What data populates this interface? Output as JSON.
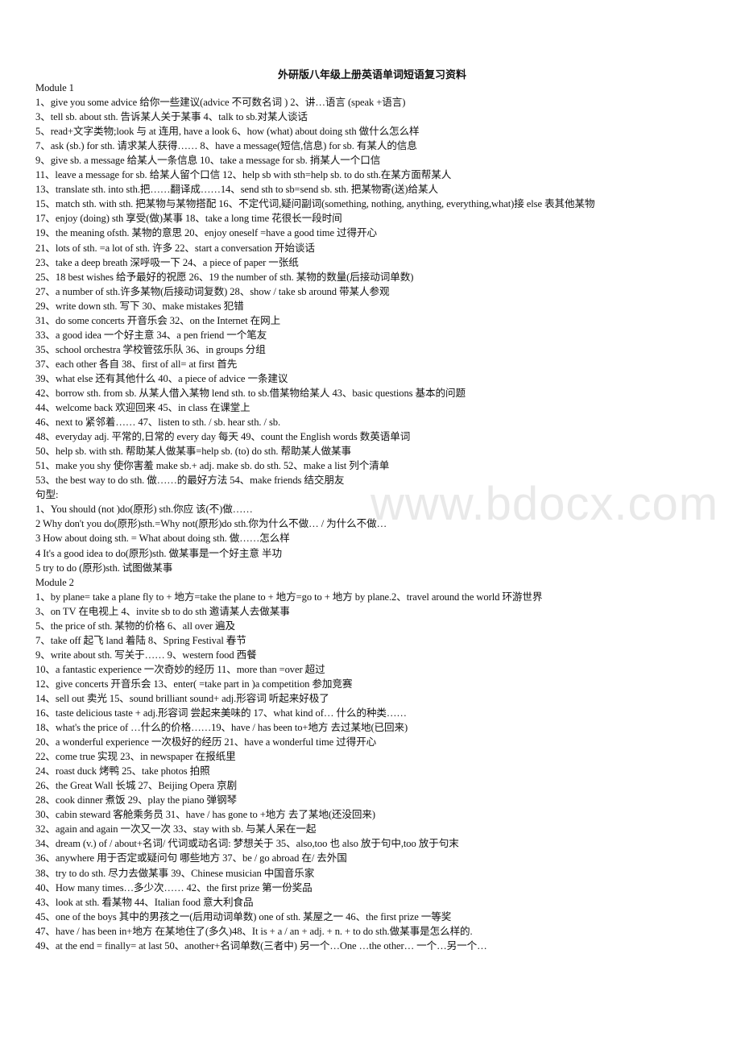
{
  "watermark": "www.bdocx.com",
  "document": {
    "title": "外研版八年级上册英语单词短语复习资料",
    "lines": [
      "Module 1",
      "1、give you some advice 给你一些建议(advice  不可数名词  ) 2、讲…语言  (speak +语言)",
      "3、tell sb. about sth.  告诉某人关于某事 4、talk to sb.对某人谈话",
      "5、read+文字类物;look 与 at  连用, have a look 6、how (what) about doing sth  做什么怎么样",
      "7、ask (sb.) for sth.  请求某人获得…… 8、have a message(短信,信息) for sb.  有某人的信息",
      "9、give sb. a message 给某人一条信息  10、take a message for sb.  捎某人一个口信",
      "11、leave a message for sb.  给某人留个口信 12、help sb with sth=help sb. to do sth.在某方面帮某人",
      "13、translate sth. into sth.把……翻译成……14、send sth to sb=send sb. sth.  把某物寄(送)给某人",
      "15、match sth. with sth.  把某物与某物搭配 16、不定代词,疑问副词(something, nothing, anything, everything,what)接 else 表其他某物",
      "17、enjoy (doing) sth  享受(做)某事  18、take a long time  花很长一段时间",
      "19、the meaning ofsth.  某物的意思  20、enjoy oneself =have a good time  过得开心",
      "21、lots of sth. =a lot of sth.  许多  22、start a conversation  开始谈话",
      "23、take a deep breath  深呼吸一下  24、a piece of paper 一张纸",
      "25、18 best wishes 给予最好的祝愿  26、19 the number of sth.  某物的数量(后接动词单数)",
      "27、a number of sth.许多某物(后接动词复数) 28、show / take sb around  带某人参观",
      "29、write down sth.  写下 30、make mistakes  犯错",
      "31、do some concerts 开音乐会 32、on the Internet  在网上",
      "33、a good idea  一个好主意 34、a pen friend  一个笔友",
      "35、school orchestra  学校管弦乐队  36、in groups  分组",
      "37、each other  各自  38、first of all= at first  首先",
      "39、what else  还有其他什么 40、a piece of advice  一条建议",
      "42、borrow sth. from sb.  从某人借入某物  lend sth. to sb.借某物给某人  43、basic questions  基本的问题",
      "44、welcome back  欢迎回来  45、in class  在课堂上",
      "46、next to  紧邻着…… 47、listen to sth. / sb. hear sth. / sb.",
      "48、everyday adj.  平常的,日常的  every day  每天 49、count the English words  数英语单词",
      "50、help sb. with sth.  帮助某人做某事=help sb. (to) do sth.  帮助某人做某事",
      "51、make you shy  使你害羞  make sb.+ adj. make sb. do sth. 52、make a list  列个清单",
      "53、the best way to do sth.  做……的最好方法  54、make friends  结交朋友",
      "句型:",
      "1、You should (not )do(原形) sth.你应  该(不)做……",
      "2 Why don't you do(原形)sth.=Why not(原形)do sth.你为什么不做… /  为什么不做…",
      "3 How about doing sth. = What about doing sth.  做……怎么样",
      "4 It's a good idea to do(原形)sth.  做某事是一个好主意  半功",
      "5 try to do (原形)sth.  试图做某事",
      "Module 2",
      "1、by plane= take a plane fly to +  地方=take the plane to +  地方=go to +  地方 by plane.2、travel around the world 环游世界",
      "3、on TV  在电视上 4、invite sb to do sth  邀请某人去做某事",
      "5、the price of sth.  某物的价格  6、all over  遍及",
      "7、take off  起飞  land 着陆  8、Spring Festival  春节",
      "9、write about sth.  写关于…… 9、western food  西餐",
      "10、a fantastic experience  一次奇妙的经历  11、more than =over  超过",
      "12、give concerts  开音乐会 13、enter( =take part in )a competition  参加竞赛",
      "14、sell out  卖光 15、sound brilliant sound+ adj.形容词  听起来好极了",
      "16、taste delicious taste + adj.形容词  尝起来美味的 17、what kind of…  什么的种类……",
      "18、what's the price of …什么的价格……19、have / has been to+地方  去过某地(已回来)",
      "20、a wonderful experience  一次极好的经历 21、have a wonderful time  过得开心",
      "22、come true  实现  23、in newspaper  在报纸里",
      "24、roast duck  烤鸭  25、take photos  拍照",
      "26、the Great Wall  长城 27、Beijing Opera  京剧",
      "28、cook dinner 煮饭  29、play the piano  弹钢琴",
      "30、cabin steward  客舱乘务员  31、have / has gone to +地方  去了某地(还没回来)",
      "32、again and again  一次又一次  33、stay with sb.  与某人呆在一起",
      "34、dream (v.) of / about+名词/  代词或动名词:  梦想关于  35、also,too  也  also 放于句中,too 放于句末",
      "36、anywhere  用于否定或疑问句  哪些地方  37、be / go abroad  在/  去外国",
      "38、try to do sth.  尽力去做某事  39、Chinese musician  中国音乐家",
      "40、How many times…多少次…… 42、the first prize  第一份奖品",
      "43、look at sth.  看某物  44、Italian food 意大利食品",
      "45、one of the boys  其中的男孩之一(后用动词单数) one of sth.  某屋之一 46、the first prize  一等奖",
      "47、have / has been in+地方  在某地住了(多久)48、It is + a / an + adj. + n. + to do sth.做某事是怎么样的.",
      "49、at the end = finally= at last 50、another+名词单数(三者中)  另一个…One …the other…  一个…另一个…"
    ]
  }
}
